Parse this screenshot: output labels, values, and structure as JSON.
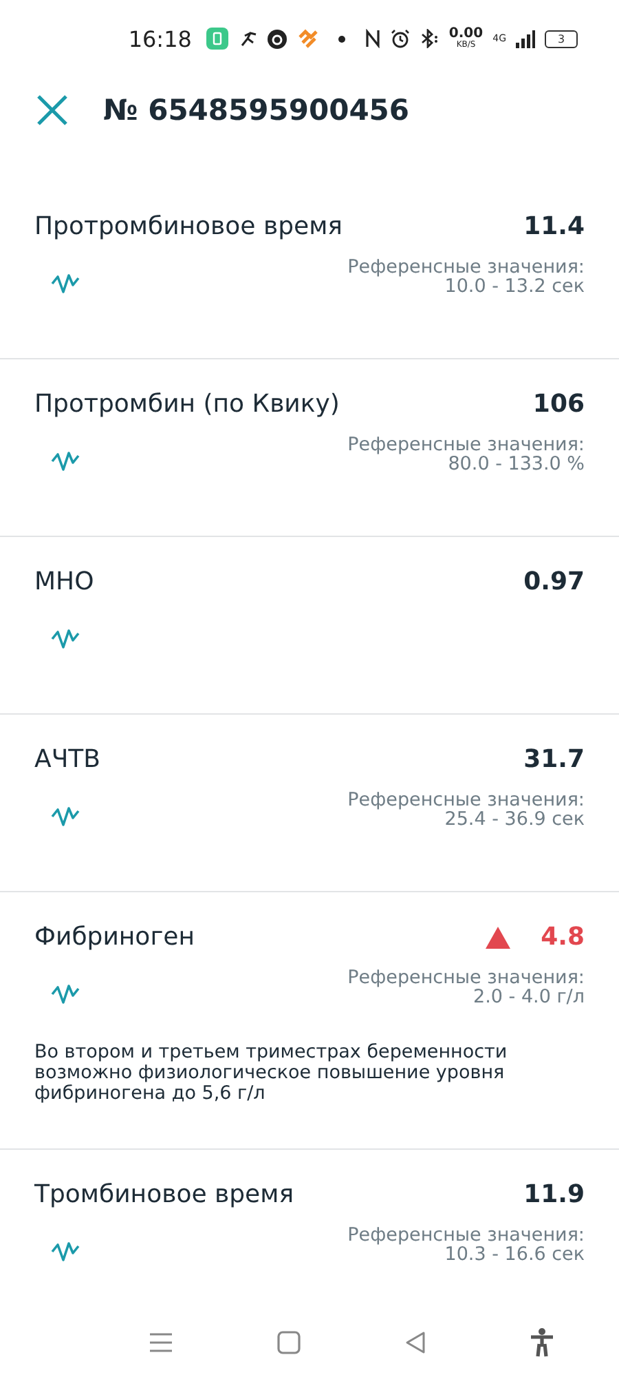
{
  "status_bar": {
    "time": "16:18",
    "net_speed": "0.00",
    "net_unit": "KB/S",
    "network": "4G",
    "battery": "3"
  },
  "header": {
    "title": "№ 6548595900456"
  },
  "results": [
    {
      "name": "Протромбиновое время",
      "value": "11.4",
      "high": false,
      "ref_label": "Референсные значения:",
      "ref_range": "10.0 - 13.2 сек"
    },
    {
      "name": "Протромбин (по Квику)",
      "value": "106",
      "high": false,
      "ref_label": "Референсные значения:",
      "ref_range": "80.0 - 133.0 %"
    },
    {
      "name": "МНО",
      "value": "0.97",
      "high": false
    },
    {
      "name": "АЧТВ",
      "value": "31.7",
      "high": false,
      "ref_label": "Референсные значения:",
      "ref_range": "25.4 - 36.9 сек"
    },
    {
      "name": "Фибриноген",
      "value": "4.8",
      "high": true,
      "ref_label": "Референсные значения:",
      "ref_range": "2.0 - 4.0 г/л",
      "note": "Во втором и третьем триместрах беременности возможно физиологическое повышение уровня фибриногена до 5,6 г/л"
    },
    {
      "name": "Тромбиновое время",
      "value": "11.9",
      "high": false,
      "ref_label": "Референсные значения:",
      "ref_range": "10.3 - 16.6 сек"
    }
  ]
}
